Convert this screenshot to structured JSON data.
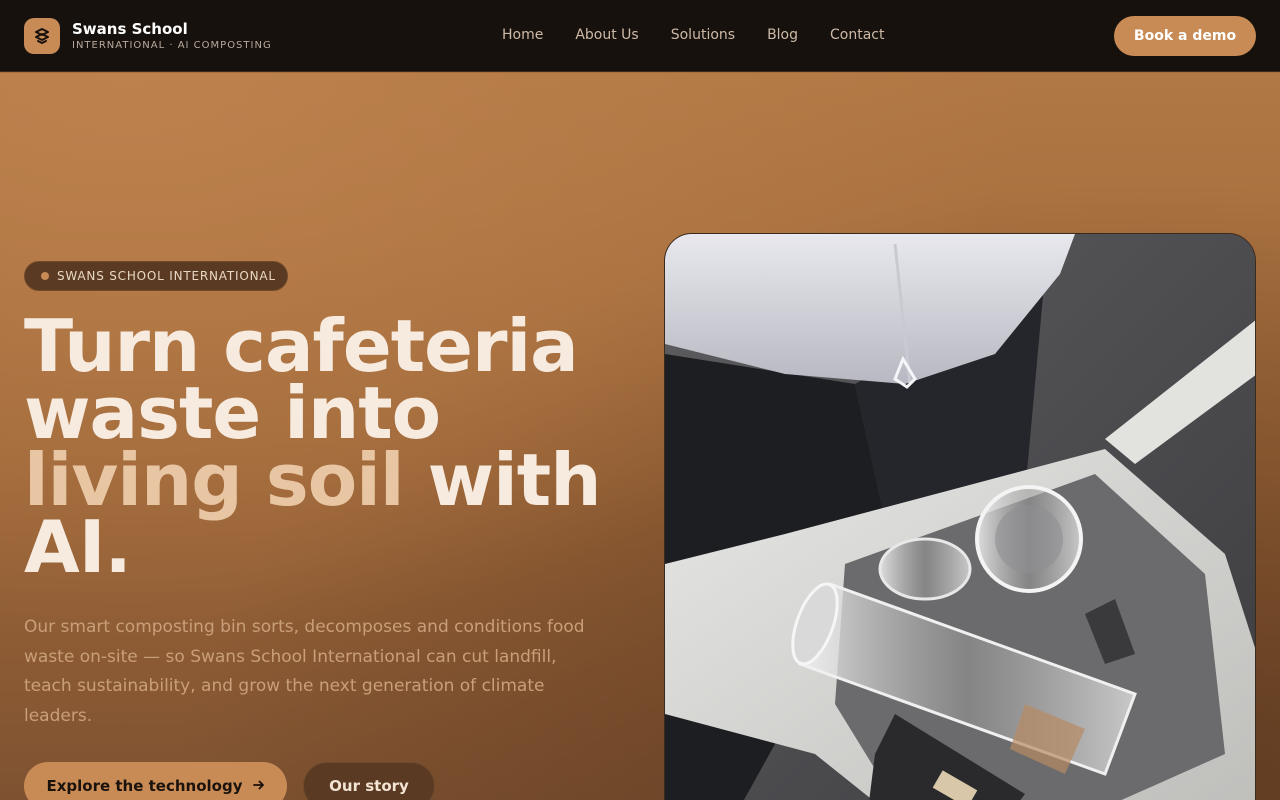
{
  "brand": {
    "title": "Swans School",
    "subtitle": "INTERNATIONAL · AI COMPOSTING",
    "logo_icon": "logo-icon"
  },
  "nav": {
    "items": [
      {
        "label": "Home"
      },
      {
        "label": "About Us"
      },
      {
        "label": "Solutions"
      },
      {
        "label": "Blog"
      },
      {
        "label": "Contact"
      }
    ],
    "cta_label": "Book a demo"
  },
  "hero": {
    "badge": "SWANS SCHOOL INTERNATIONAL",
    "headline_line1": "Turn cafeteria",
    "headline_line2": "waste into",
    "headline_accent": "living soil",
    "headline_after_accent": " with",
    "headline_line4": "AI.",
    "lede": "Our smart composting bin sorts, decomposes and conditions food waste on-site — so Swans School International can cut landfill, teach sustainability, and grow the next generation of climate leaders.",
    "primary_cta": "Explore the technology",
    "primary_cta_icon": "arrow-right-icon",
    "secondary_cta": "Our story"
  },
  "colors": {
    "accent": "#c98b56",
    "nav_bg": "#17110d",
    "headline": "#f7ebe0",
    "headline_accent": "#e8c6a3"
  }
}
